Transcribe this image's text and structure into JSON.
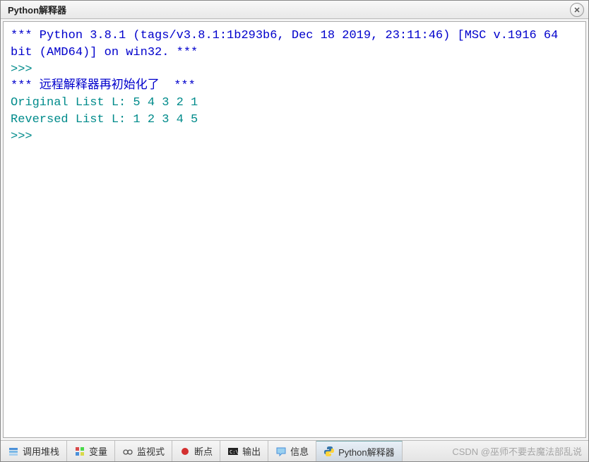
{
  "window": {
    "title": "Python解释器"
  },
  "terminal": {
    "line1": "*** Python 3.8.1 (tags/v3.8.1:1b293b6, Dec 18 2019, 23:11:46) [MSC v.1916 64 bit (AMD64)] on win32. ***",
    "prompt1": ">>> ",
    "line2": "*** 远程解释器再初始化了  ***",
    "line3": "Original List L: 5 4 3 2 1",
    "line4": "Reversed List L: 1 2 3 4 5",
    "prompt2": ">>> "
  },
  "tabs": [
    {
      "label": "调用堆栈"
    },
    {
      "label": "变量"
    },
    {
      "label": "监视式"
    },
    {
      "label": "断点"
    },
    {
      "label": "输出"
    },
    {
      "label": "信息"
    },
    {
      "label": "Python解释器"
    }
  ],
  "watermark": "CSDN @巫师不要去魔法部乱说"
}
